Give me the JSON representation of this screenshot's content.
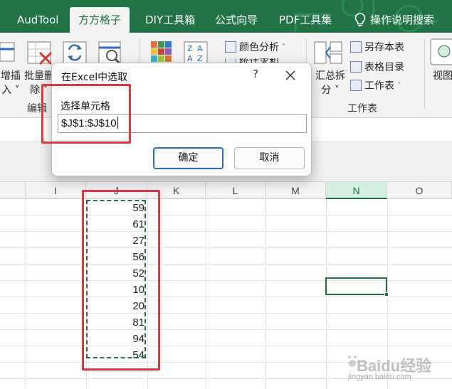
{
  "ribbon_tabs": {
    "audtool": "AudTool",
    "fangfang": "方方格子",
    "diy": "DIY工具箱",
    "formula_wizard": "公式向导",
    "pdf": "PDF工具集",
    "help_search": "操作说明搜索"
  },
  "ribbon": {
    "insert_label": "增插",
    "insert_sub": "入 ˅",
    "batch_delete_label": "批量删",
    "batch_delete_sub": "除 ˅",
    "edit_group": "编辑",
    "color_analysis": "颜色分析",
    "stats_partial": "统计求和",
    "summary_split": "汇总拆",
    "summary_split_sub": "分 ˅",
    "save_as_book": "另存本表",
    "sheet_directory": "表格目录",
    "worksheet": "工作表",
    "worksheet_group": "工作表",
    "view": "视图"
  },
  "columns": {
    "i": "I",
    "j": "J",
    "k": "K",
    "l": "L",
    "m": "M",
    "n": "N",
    "o": "O"
  },
  "column_j_values": [
    "59",
    "61",
    "27",
    "56",
    "52",
    "10",
    "20",
    "81",
    "94",
    "54"
  ],
  "dialog": {
    "title": "在Excel中选取",
    "help": "?",
    "field_label": "选择单元格",
    "field_value": "$J$1:$J$10",
    "ok": "确定",
    "cancel": "取消"
  },
  "watermark": {
    "brand": "Baidu经验",
    "url": "jingyan.baidu.com"
  },
  "colors": {
    "excel_green": "#217346",
    "annotation_red": "#e0383e",
    "primary_button_border": "#2a6ebf"
  }
}
